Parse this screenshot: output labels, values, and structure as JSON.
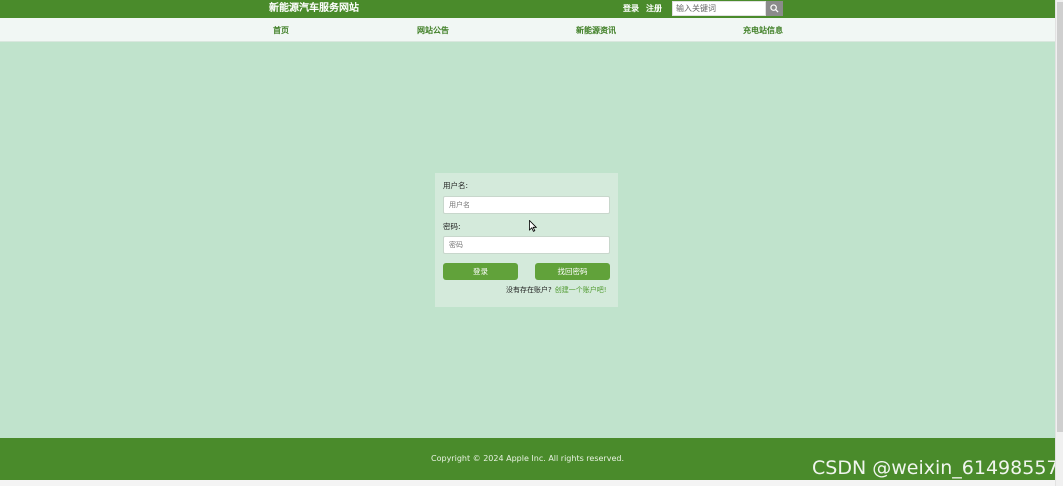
{
  "header": {
    "site_title": "新能源汽车服务网站",
    "login_link": "登录",
    "register_link": "注册",
    "search": {
      "placeholder": "输入关键词",
      "icon": "search-icon"
    }
  },
  "nav": {
    "items": [
      {
        "label": "首页"
      },
      {
        "label": "网站公告"
      },
      {
        "label": "新能源资讯"
      },
      {
        "label": "充电站信息"
      }
    ]
  },
  "login_form": {
    "username_label": "用户名:",
    "username_placeholder": "用户名",
    "password_label": "密码:",
    "password_placeholder": "密码",
    "login_button": "登录",
    "forgot_button": "找回密码",
    "no_account_text": "没有存在账户?",
    "create_account_link": "创建一个账户吧!"
  },
  "footer": {
    "copyright": "Copyright © 2024 Apple Inc. All rights reserved."
  },
  "watermark": "CSDN @weixin_61498557",
  "colors": {
    "brand_green": "#4a8b2b",
    "page_bg": "#c0e3cc",
    "button_green": "#61a23a"
  }
}
